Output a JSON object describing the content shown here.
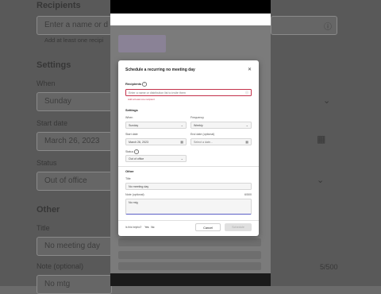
{
  "background": {
    "recipients_label": "Recipients",
    "recipients_placeholder": "Enter a name or d",
    "recipients_hint": "Add at least one recipi",
    "settings_label": "Settings",
    "when_label": "When",
    "when_value": "Sunday",
    "start_date_label": "Start date",
    "start_date_value": "March 26, 2023",
    "status_label": "Status",
    "status_value": "Out of office",
    "other_label": "Other",
    "title_label": "Title",
    "title_value": "No meeting day",
    "note_label": "Note (optional)",
    "note_counter": "5/500",
    "note_value": "No mtg"
  },
  "modal": {
    "title": "Schedule a recurring no meeting day",
    "recipients": {
      "label": "Recipients",
      "placeholder": "Enter a name or distribution list to invite them",
      "error": "Add at least one recipient"
    },
    "settings_heading": "Settings",
    "when": {
      "label": "When",
      "value": "Sunday"
    },
    "frequency": {
      "label": "Frequency",
      "value": "Weekly"
    },
    "start_date": {
      "label": "Start date",
      "value": "March 26, 2023"
    },
    "end_date": {
      "label": "End date (optional)",
      "placeholder": "Select a date..."
    },
    "status": {
      "label": "Status",
      "value": "Out of office"
    },
    "other_heading": "Other",
    "title_field": {
      "label": "Title",
      "value": "No meeting day"
    },
    "note_field": {
      "label": "Note (optional)",
      "counter": "6/500",
      "value": "No mtg"
    },
    "helpful": {
      "question": "Is this helpful?",
      "yes": "Yes",
      "no": "No"
    },
    "buttons": {
      "cancel": "Cancel",
      "submit": "Schedule"
    }
  },
  "colors": {
    "error": "#c4314b",
    "accent": "#5b5fc7",
    "modal_bg": "#ffffff",
    "overlay": "#5f5f5f"
  },
  "icons": {
    "close": "close-icon",
    "info": "info-icon",
    "calendar": "calendar-icon",
    "chevron": "chevron-down-icon"
  }
}
